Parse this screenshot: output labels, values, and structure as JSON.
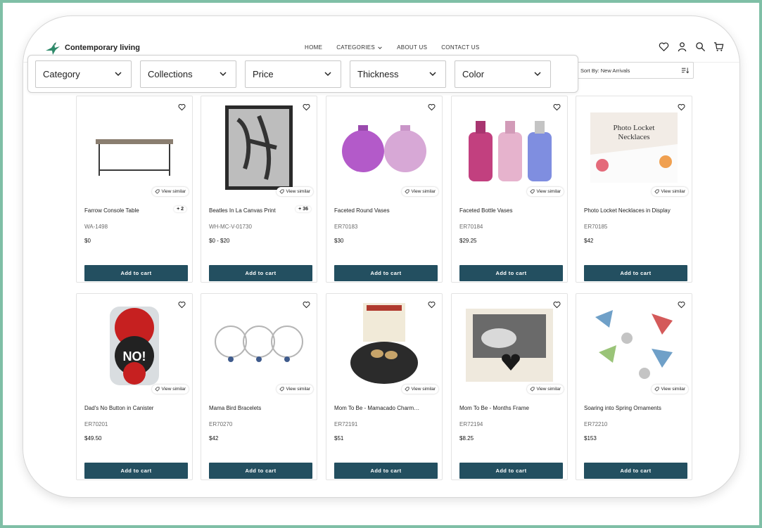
{
  "brand": {
    "name": "Contemporary living",
    "logo_icon": "hummingbird-logo-icon"
  },
  "nav": [
    {
      "label": "HOME"
    },
    {
      "label": "CATEGORIES",
      "has_dropdown": true
    },
    {
      "label": "ABOUT US"
    },
    {
      "label": "CONTACT US"
    }
  ],
  "header_icons": [
    "heart-icon",
    "user-icon",
    "search-icon",
    "cart-icon"
  ],
  "filters": [
    {
      "label": "Category"
    },
    {
      "label": "Collections"
    },
    {
      "label": "Price"
    },
    {
      "label": "Thickness"
    },
    {
      "label": "Color"
    }
  ],
  "sort": {
    "label": "Sort By: New Arrivals"
  },
  "view_similar_label": "View similar",
  "add_to_cart_label": "Add to cart",
  "colors": {
    "button": "#234f60",
    "frame": "#7fbfa6"
  },
  "products": [
    {
      "name": "Farrow Console Table",
      "sku": "WA-1498",
      "price": "$0",
      "variants": "+ 2",
      "image": "console-table-image"
    },
    {
      "name": "Beatles In La Canvas Print",
      "sku": "WH-MC-V-01730",
      "price": "$0 - $20",
      "variants": "+ 36",
      "image": "photo-print-image"
    },
    {
      "name": "Faceted Round Vases",
      "sku": "ER70183",
      "price": "$30",
      "variants": "",
      "image": "round-vases-image"
    },
    {
      "name": "Faceted Bottle Vases",
      "sku": "ER70184",
      "price": "$29.25",
      "variants": "",
      "image": "bottle-vases-image"
    },
    {
      "name": "Photo Locket Necklaces in Display",
      "sku": "ER70185",
      "price": "$42",
      "variants": "",
      "image": "locket-display-image"
    },
    {
      "name": "Dad's No Button in Canister",
      "sku": "ER70201",
      "price": "$49.50",
      "variants": "",
      "image": "no-button-canister-image"
    },
    {
      "name": "Mama Bird Bracelets",
      "sku": "ER70270",
      "price": "$42",
      "variants": "",
      "image": "bracelets-image"
    },
    {
      "name": "Mom To Be - Mamacado Charms i...",
      "sku": "ER72191",
      "price": "$51",
      "variants": "",
      "image": "mamacado-basket-image"
    },
    {
      "name": "Mom To Be - Months Frame",
      "sku": "ER72194",
      "price": "$8.25",
      "variants": "",
      "image": "months-frame-image"
    },
    {
      "name": "Soaring into Spring Ornaments",
      "sku": "ER72210",
      "price": "$153",
      "variants": "",
      "image": "ornaments-image"
    }
  ]
}
